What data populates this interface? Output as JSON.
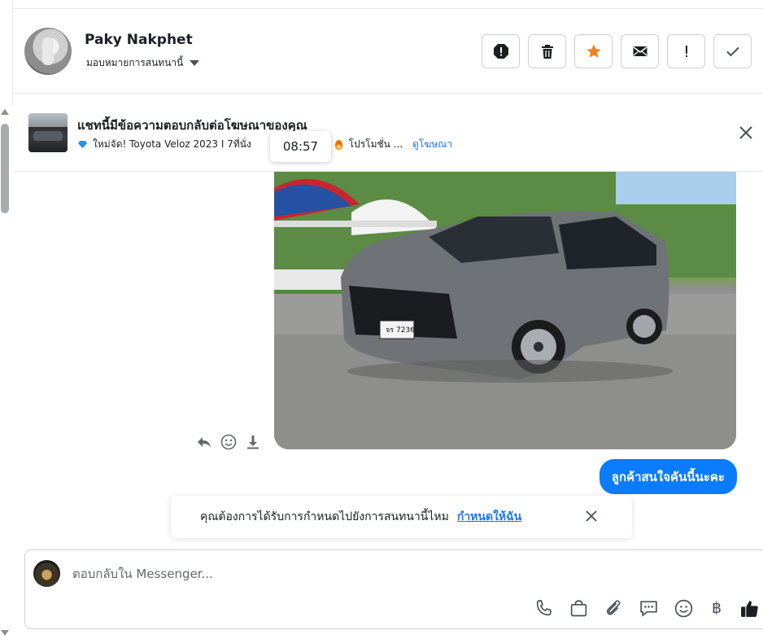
{
  "contact": {
    "name": "Paky Nakphet",
    "assign_label": "มอบหมายการสนทนานี้"
  },
  "actions": [
    {
      "icon": "alert-circle-icon",
      "label": "Spam"
    },
    {
      "icon": "trash-icon",
      "label": "Delete"
    },
    {
      "icon": "star-icon",
      "label": "Star"
    },
    {
      "icon": "envelope-icon",
      "label": "Mark unread"
    },
    {
      "icon": "exclamation-icon",
      "label": "Follow up"
    },
    {
      "icon": "check-icon",
      "label": "Done"
    }
  ],
  "ad_banner": {
    "title": "แชทนี้มีข้อความตอบกลับต่อโฆษณาของคุณ",
    "subtitle_part1": "ใหม่จัด! Toyota Veloz 2023 I 7ที่นั่ง",
    "subtitle_part2": "!",
    "subtitle_part3": "โปรโมชั่น ...",
    "link": "ดูโฆษณา"
  },
  "timestamp_tooltip": "08:57",
  "outgoing_message": "ลูกค้าสนใจคันนี้นะคะ",
  "assign_prompt": {
    "text": "คุณต้องการได้รับการกำหนดไปยังการสนทนานี้ไหม",
    "link": "กำหนดให้ฉัน"
  },
  "composer": {
    "placeholder": "ตอบกลับใน Messenger...",
    "currency_symbol": "฿"
  },
  "colors": {
    "accent": "#1877f2",
    "bubble": "#0a7cff",
    "star": "#f5821f"
  }
}
